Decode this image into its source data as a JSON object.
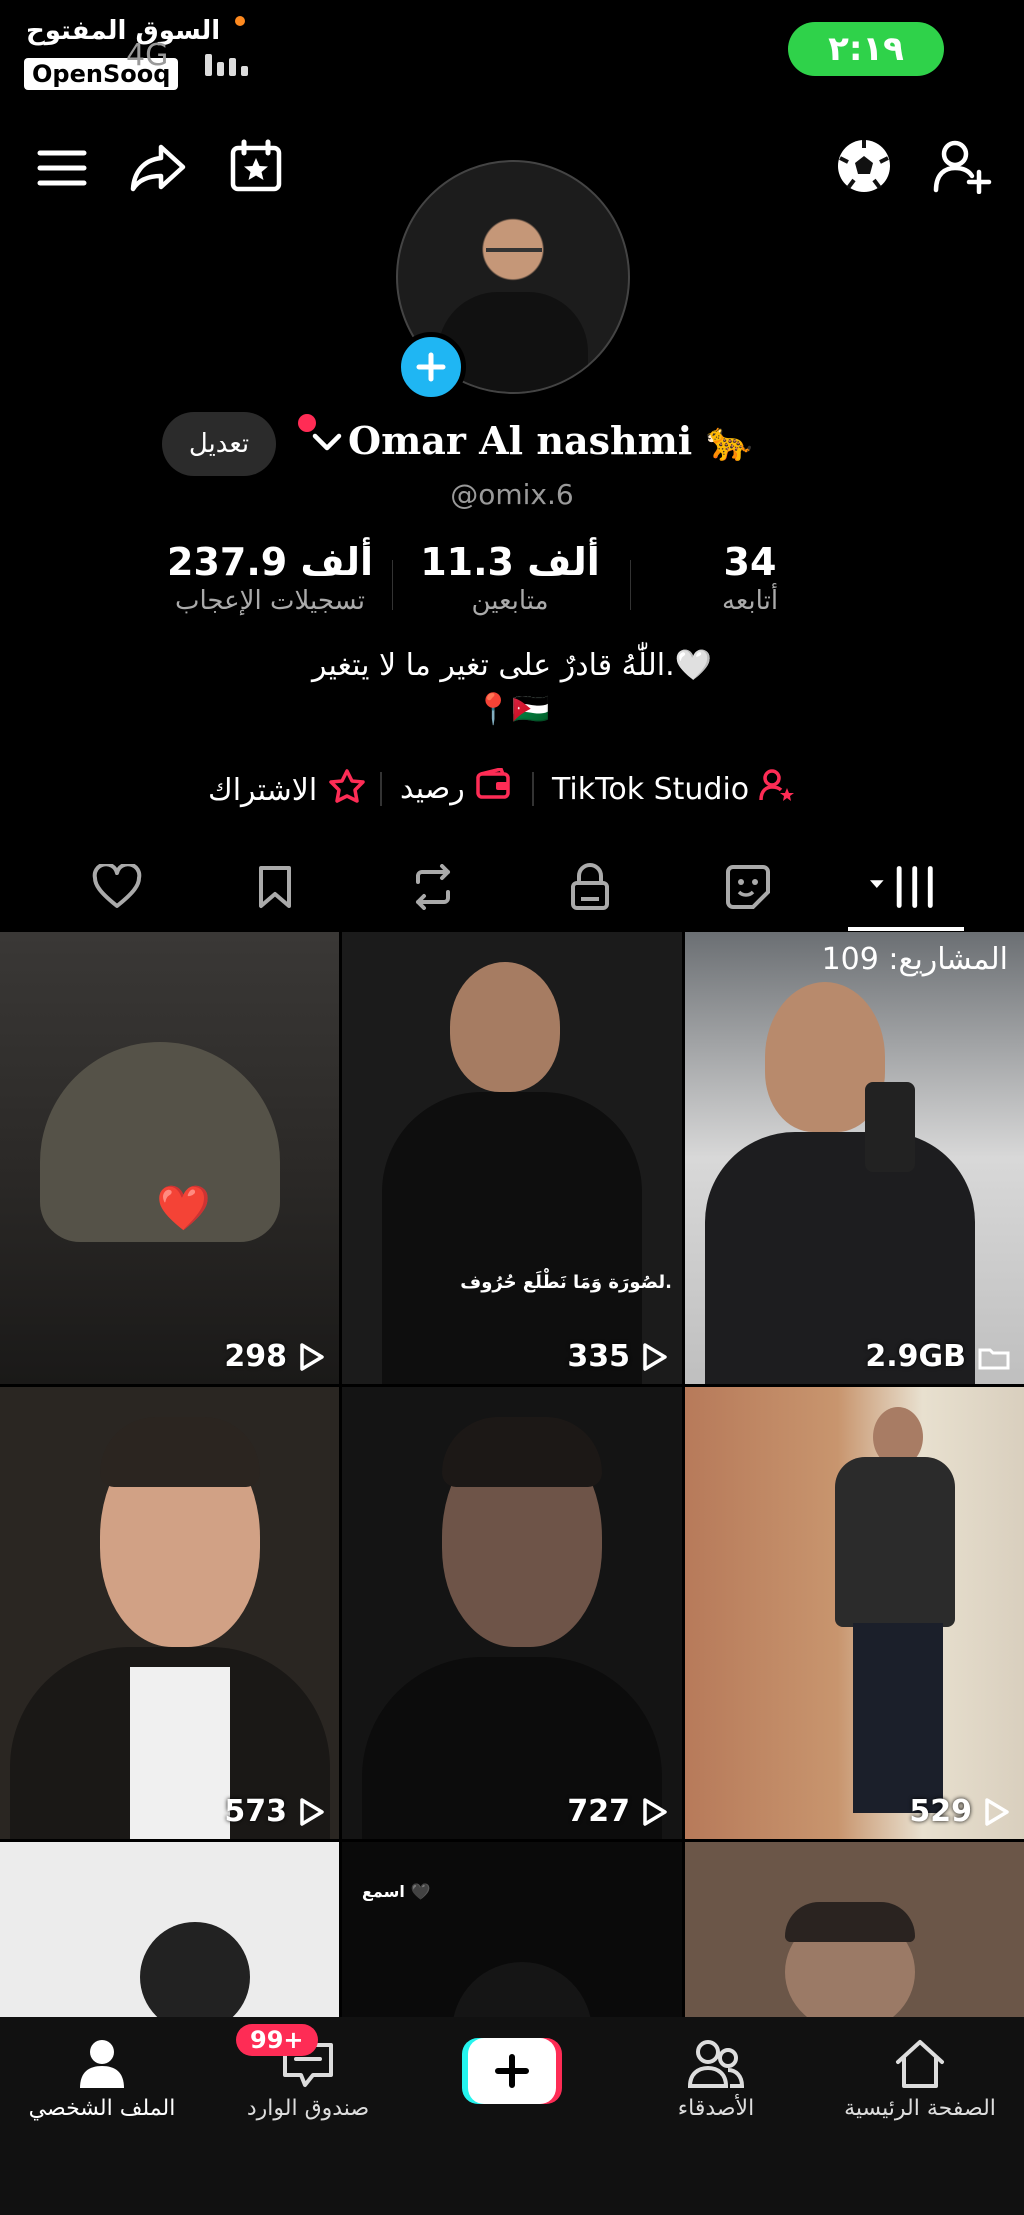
{
  "status": {
    "time": "٢:١٩",
    "network": "4G",
    "watermark_ar": "السوق المفتوح",
    "watermark_en": "OpenSooq"
  },
  "header": {
    "icons": [
      "menu-icon",
      "share-icon",
      "calendar-star-icon",
      "soccer-ball-icon",
      "add-friend-icon"
    ]
  },
  "profile": {
    "name": "Omar Al nashmi 🐆",
    "handle": "@omix.6",
    "edit_label": "تعديل",
    "bio": "اللّٰهُ قادرٌ على تغير ما لا يتغير.🤍",
    "location": "📍🇯🇴"
  },
  "stats": {
    "following": {
      "value": "34",
      "label": "أتابعه"
    },
    "followers": {
      "value": "11.3 ألف",
      "label": "متابعين"
    },
    "likes": {
      "value": "237.9 ألف",
      "label": "تسجيلات الإعجاب"
    }
  },
  "links": {
    "studio": "TikTok Studio",
    "balance": "رصيد",
    "subscription": "الاشتراك"
  },
  "tabs": [
    "videos-grid-icon",
    "stickers-icon",
    "lock-icon",
    "repost-icon",
    "bookmark-icon",
    "heart-icon"
  ],
  "grid": {
    "projects_label": "المشاريع: 109",
    "storage": "2.9GB",
    "tiles": [
      {
        "count": "298"
      },
      {
        "count": "335",
        "caption": "لصُورَة وَمَا نَطْلَع حُرُوف."
      },
      {
        "count": ""
      },
      {
        "count": "573"
      },
      {
        "count": "727"
      },
      {
        "count": "529"
      },
      {
        "count": ""
      },
      {
        "count": "",
        "caption": "اسمع 🖤"
      },
      {
        "count": ""
      }
    ]
  },
  "bottom_nav": {
    "home": "الصفحة الرئيسية",
    "friends": "الأصدقاء",
    "inbox": "صندوق الوارد",
    "inbox_badge": "99+",
    "profile": "الملف الشخصي"
  },
  "colors": {
    "accent": "#fe2c55",
    "cyan": "#25f4ee",
    "status_green": "#2fd24a",
    "avatar_add": "#1fb6f3"
  }
}
